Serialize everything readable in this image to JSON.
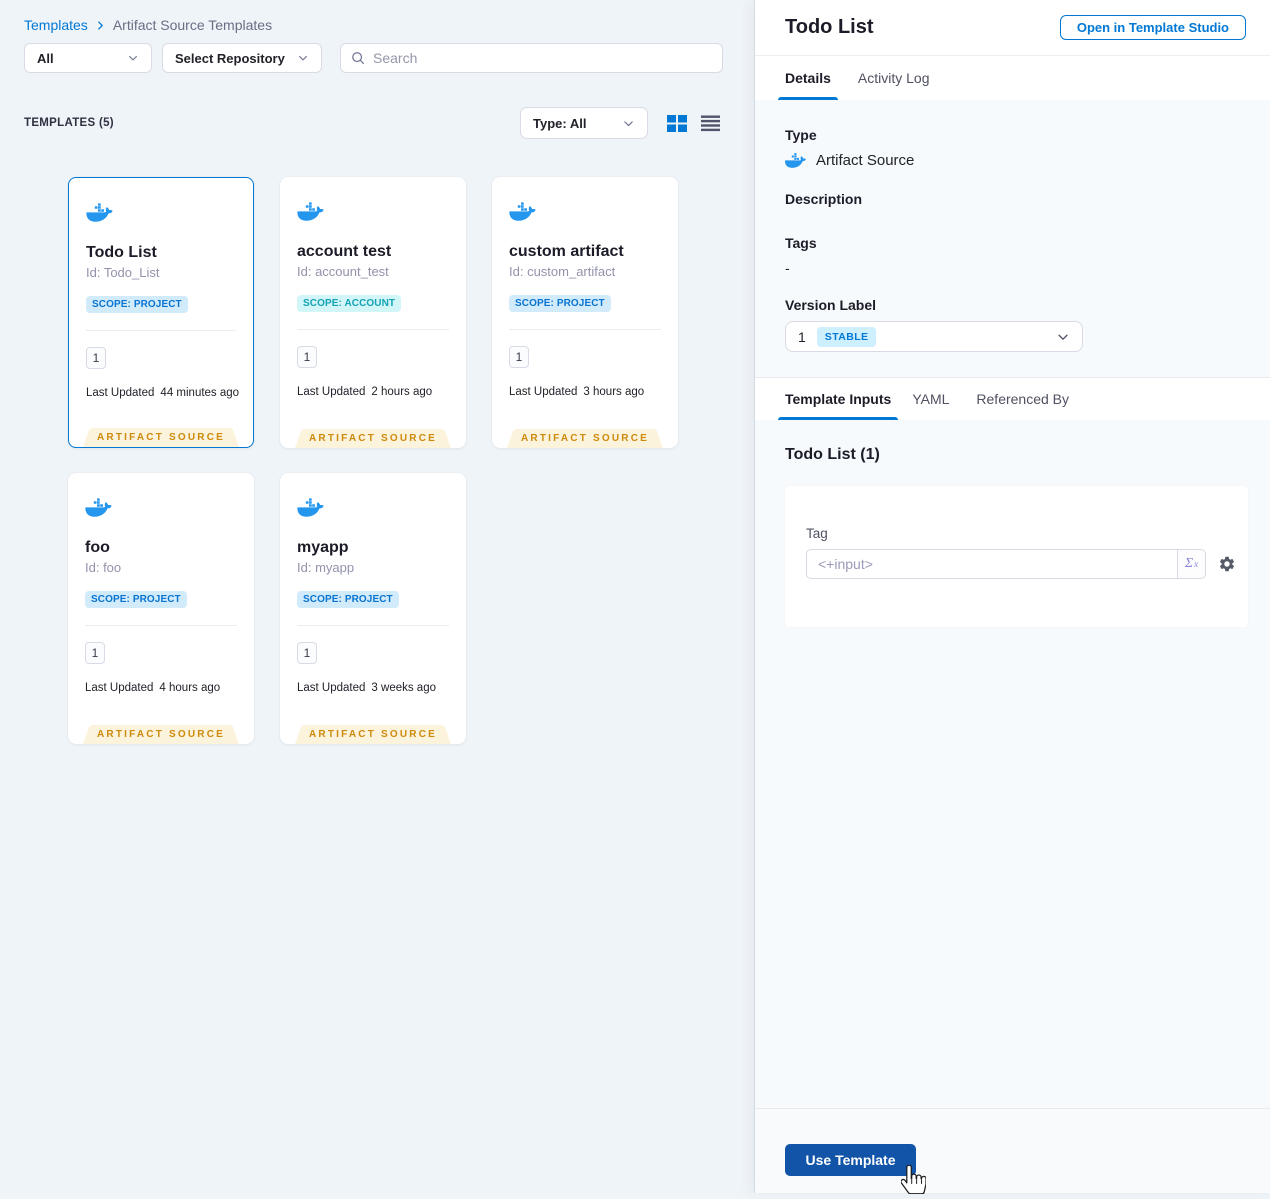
{
  "breadcrumb": {
    "root": "Templates",
    "current": "Artifact Source Templates"
  },
  "filters": {
    "scope_dropdown": "All",
    "repository_dropdown": "Select Repository",
    "search_placeholder": "Search"
  },
  "toolbar": {
    "count_label": "TEMPLATES (5)",
    "type_filter": "Type: All"
  },
  "cards": [
    {
      "title": "Todo List",
      "id": "Id: Todo_List",
      "scope": "SCOPE: PROJECT",
      "version": "1",
      "last_updated_label": "Last Updated",
      "last_updated": "44 minutes ago",
      "footer": "ARTIFACT SOURCE"
    },
    {
      "title": "account test",
      "id": "Id: account_test",
      "scope": "SCOPE: ACCOUNT",
      "version": "1",
      "last_updated_label": "Last Updated",
      "last_updated": "2 hours ago",
      "footer": "ARTIFACT SOURCE"
    },
    {
      "title": "custom artifact",
      "id": "Id: custom_artifact",
      "scope": "SCOPE: PROJECT",
      "version": "1",
      "last_updated_label": "Last Updated",
      "last_updated": "3 hours ago",
      "footer": "ARTIFACT SOURCE"
    },
    {
      "title": "foo",
      "id": "Id: foo",
      "scope": "SCOPE: PROJECT",
      "version": "1",
      "last_updated_label": "Last Updated",
      "last_updated": "4 hours ago",
      "footer": "ARTIFACT SOURCE"
    },
    {
      "title": "myapp",
      "id": "Id: myapp",
      "scope": "SCOPE: PROJECT",
      "version": "1",
      "last_updated_label": "Last Updated",
      "last_updated": "3 weeks ago",
      "footer": "ARTIFACT SOURCE"
    }
  ],
  "details_panel": {
    "title": "Todo List",
    "open_studio_button": "Open in Template Studio",
    "tabs": {
      "details": "Details",
      "activity_log": "Activity Log"
    },
    "fields": {
      "type_label": "Type",
      "type_value": "Artifact Source",
      "description_label": "Description",
      "tags_label": "Tags",
      "tags_value": "-",
      "version_label": "Version Label",
      "version_value": "1",
      "version_badge": "STABLE"
    },
    "inputs_tabs": {
      "template_inputs": "Template Inputs",
      "yaml": "YAML",
      "referenced_by": "Referenced By"
    },
    "inputs_section": {
      "heading": "Todo List (1)",
      "tag_label": "Tag",
      "tag_value": "<+input>",
      "expression_symbol": "Σ",
      "expression_sup": "x"
    },
    "footer": {
      "use_template_button": "Use Template"
    }
  },
  "colors": {
    "accent_blue": "#0278D5",
    "primary_button_blue": "#1254A8",
    "badge_project_bg": "#D2EBFA",
    "badge_account_bg": "#D2F5F8",
    "artifact_footer_bg": "#FBF3DC",
    "artifact_footer_text": "#CE8A0C",
    "docker_blue": "#2496ED"
  }
}
